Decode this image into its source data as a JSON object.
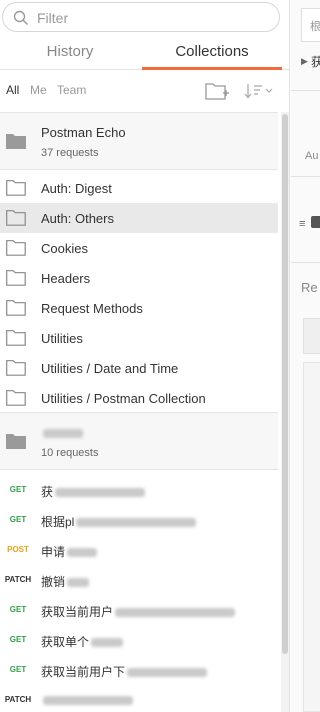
{
  "search": {
    "placeholder": "Filter"
  },
  "tabs": [
    {
      "label": "History",
      "active": false
    },
    {
      "label": "Collections",
      "active": true
    }
  ],
  "filters": [
    {
      "label": "All",
      "active": true
    },
    {
      "label": "Me",
      "active": false
    },
    {
      "label": "Team",
      "active": false
    }
  ],
  "collections": [
    {
      "name": "Postman Echo",
      "count": "37 requests",
      "folders": [
        {
          "label": "Auth: Digest",
          "highlighted": false
        },
        {
          "label": "Auth: Others",
          "highlighted": true
        },
        {
          "label": "Cookies",
          "highlighted": false
        },
        {
          "label": "Headers",
          "highlighted": false
        },
        {
          "label": "Request Methods",
          "highlighted": false
        },
        {
          "label": "Utilities",
          "highlighted": false
        },
        {
          "label": "Utilities / Date and Time",
          "highlighted": false
        },
        {
          "label": "Utilities / Postman Collection",
          "highlighted": false
        }
      ]
    },
    {
      "name": "",
      "count": "10 requests",
      "requests": [
        {
          "method": "GET",
          "name": "获"
        },
        {
          "method": "GET",
          "name": "根据pl"
        },
        {
          "method": "POST",
          "name": "申请"
        },
        {
          "method": "PATCH",
          "name": "撤销"
        },
        {
          "method": "GET",
          "name": "获取当前用户"
        },
        {
          "method": "GET",
          "name": "获取单个"
        },
        {
          "method": "GET",
          "name": "获取当前用户下"
        },
        {
          "method": "PATCH",
          "name": ""
        }
      ]
    }
  ],
  "right_panel": {
    "input_text": "根",
    "line1": "获",
    "au_label": "Au",
    "re_label": "Re"
  },
  "colors": {
    "accent": "#f26b3a",
    "get": "#34a048",
    "post": "#e8a51a"
  }
}
